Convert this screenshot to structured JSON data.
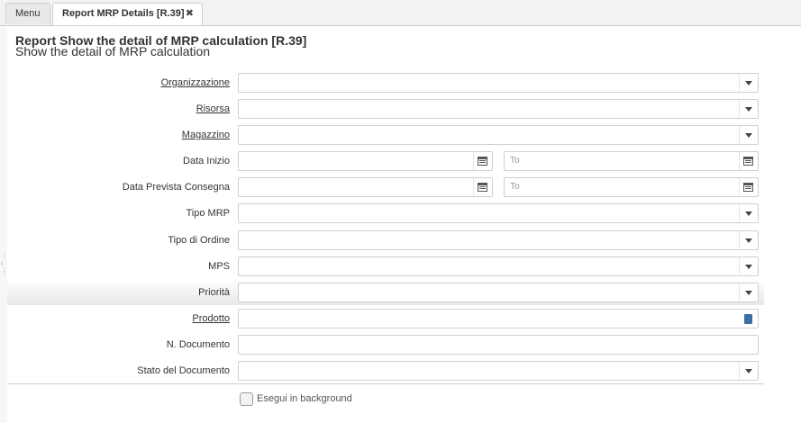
{
  "tabs": [
    {
      "label": "Menu"
    },
    {
      "label": "Report MRP Details [R.39]",
      "close": "✖"
    }
  ],
  "header": {
    "title": "Report Show the detail of MRP calculation [R.39]",
    "subtitle": "Show the detail of MRP calculation"
  },
  "form": {
    "organizzazione": "Organizzazione",
    "risorsa": "Risorsa",
    "magazzino": "Magazzino",
    "data_inizio": "Data Inizio",
    "data_prevista": "Data Prevista Consegna",
    "tipo_mrp": "Tipo MRP",
    "tipo_ordine": "Tipo di Ordine",
    "mps": "MPS",
    "priorita": "Priorità",
    "prodotto": "Prodotto",
    "n_documento": "N. Documento",
    "stato_documento": "Stato del Documento",
    "to_placeholder": "To"
  },
  "background": {
    "label": "Esegui in background"
  },
  "icons": {
    "dropdown": "chevron-down-icon",
    "calendar": "calendar-icon",
    "lookup": "book-icon",
    "close": "close-icon"
  }
}
